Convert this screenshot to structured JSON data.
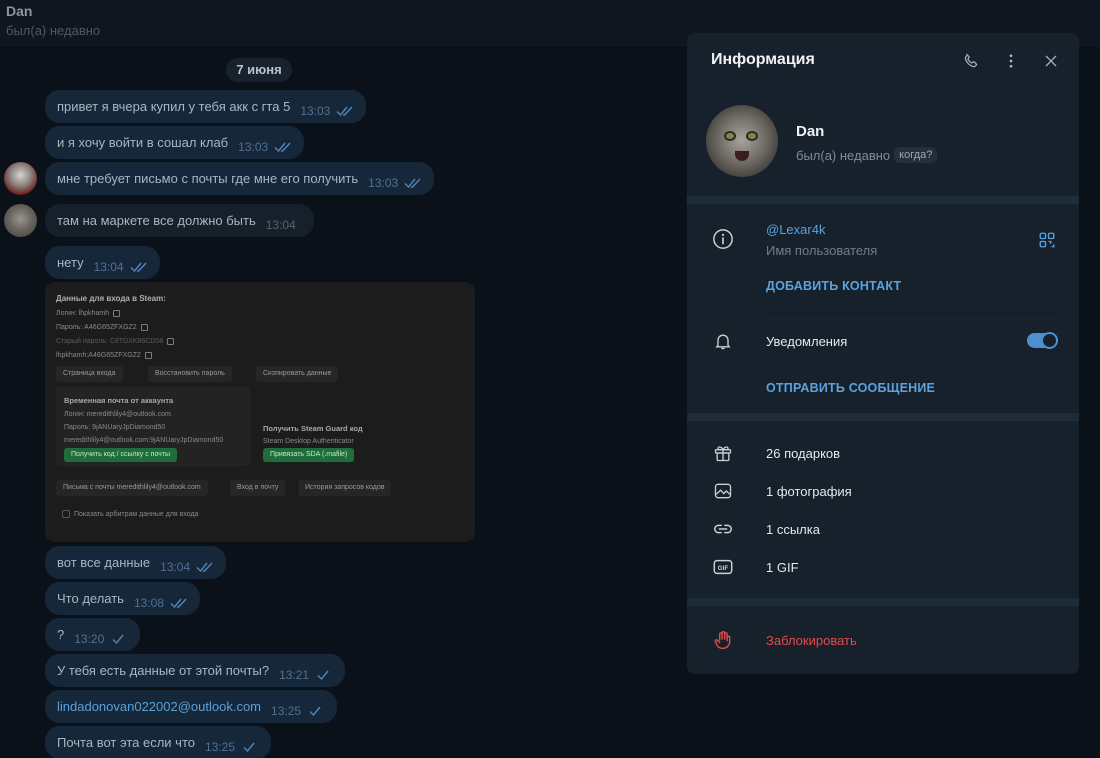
{
  "header": {
    "name": "Dan",
    "status": "был(а) недавно"
  },
  "date_pill": "7 июня",
  "messages": [
    {
      "text": "привет я вчера купил у тебя акк с гта 5",
      "time": "13:03"
    },
    {
      "text": "и я хочу войти в сошал клаб",
      "time": "13:03"
    },
    {
      "text": "мне требует письмо с почты где мне его получить",
      "time": "13:03"
    },
    {
      "text": "там на маркете все должно быть",
      "time": "13:04"
    },
    {
      "text": "нету",
      "time": "13:04"
    },
    {
      "text": "вот все данные",
      "time": "13:04"
    },
    {
      "text": "Что делать",
      "time": "13:08"
    },
    {
      "text": "?",
      "time": "13:20"
    },
    {
      "text": "У тебя есть данные от этой почты?",
      "time": "13:21"
    },
    {
      "text": "lindadonovan022002@outlook.com",
      "time": "13:25"
    },
    {
      "text": "Почта вот эта если что",
      "time": "13:25"
    }
  ],
  "screenshot": {
    "title": "Данные для входа в Steam:",
    "login": "Логин: lhpkhamh",
    "password": "Пароль: A46G65ZFXGZ2",
    "old_password": "Старый пароль: C8TDXK86CD58",
    "combo": "lhpkhamh:A46G65ZFXGZ2",
    "btn_login_page": "Страница входа",
    "btn_restore": "Восстановить пароль",
    "btn_copy": "Скопировать данные",
    "temp_mail_title": "Временная почта от аккаунта",
    "mail_login": "Логин: meredithlily4@outlook.com",
    "mail_password": "Пароль: 9jANUaryJpDiamond50",
    "mail_combo": "meredithlily4@outlook.com:9jANUaryJpDiamond50",
    "btn_get_code": "Получить код / ссылку с почты",
    "guard_title": "Получить Steam Guard код",
    "guard_sub": "Steam Desktop Authenticator",
    "btn_bind_sda": "Привязать SDA (.mafile)",
    "btn_letters": "Письма с почты meredithlily4@outlook.com",
    "btn_mail_login": "Вход в почту",
    "btn_history": "История запросов кодов",
    "arb_checkbox": "Показать арбитрам данные для входа"
  },
  "info_panel": {
    "title": "Информация",
    "name": "Dan",
    "status": "был(а) недавно",
    "when_badge": "когда?",
    "username": "@Lexar4k",
    "username_label": "Имя пользователя",
    "add_contact": "ДОБАВИТЬ КОНТАКТ",
    "notifications": "Уведомления",
    "notifications_on": true,
    "send_message": "ОТПРАВИТЬ СООБЩЕНИЕ",
    "gifts": "26 подарков",
    "photos": "1 фотография",
    "links": "1 ссылка",
    "gifs": "1 GIF",
    "block": "Заблокировать"
  },
  "colors": {
    "background": "#0b1119",
    "bubble_out": "#17273a",
    "panel": "#17212b",
    "accent": "#5aa3e0",
    "danger": "#e24b4b",
    "toggle": "#4f8ed0"
  },
  "icons": [
    "phone-icon",
    "more-vertical-icon",
    "close-icon",
    "info-icon",
    "qr-code-icon",
    "bell-icon",
    "gift-icon",
    "photo-icon",
    "link-icon",
    "gif-icon",
    "hand-icon",
    "double-check-icon",
    "single-check-icon"
  ]
}
